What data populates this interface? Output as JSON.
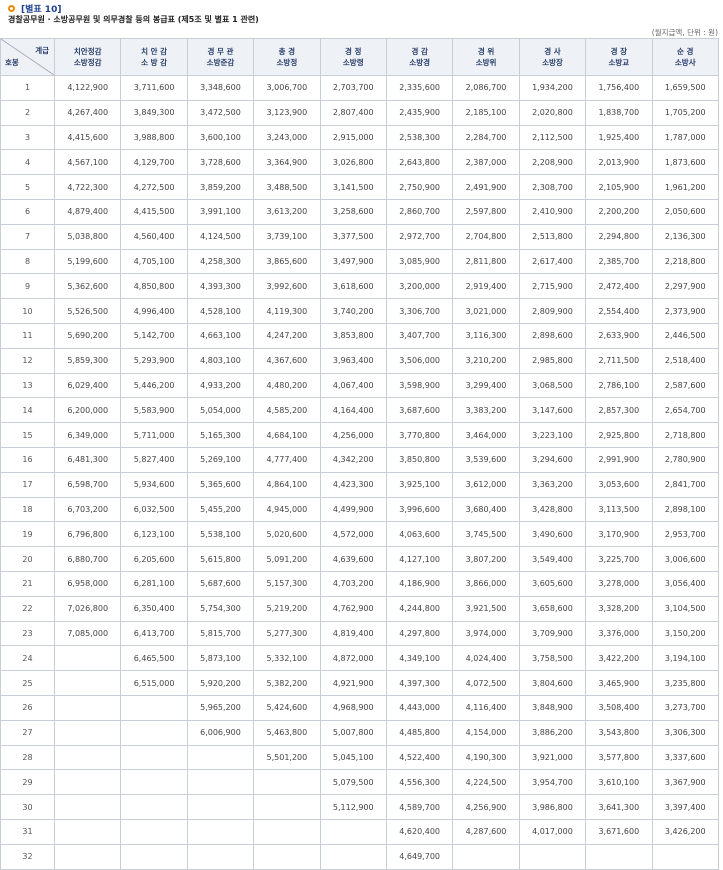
{
  "header": {
    "tag": "[별표 10]",
    "subtitle": "경찰공무원 · 소방공무원 및 의무경찰 등의 봉급표 (제5조 및 별표 1 관련)",
    "unit": "(월지급액, 단위 : 원)"
  },
  "table": {
    "corner_top": "계급",
    "corner_bottom": "호봉",
    "columns": [
      {
        "l1": "치안정감",
        "l2": "소방정감"
      },
      {
        "l1": "치 안 감",
        "l2": "소 방 감"
      },
      {
        "l1": "경 무 관",
        "l2": "소방준감"
      },
      {
        "l1": "총 경",
        "l2": "소방정"
      },
      {
        "l1": "경 정",
        "l2": "소방령"
      },
      {
        "l1": "경 감",
        "l2": "소방경"
      },
      {
        "l1": "경 위",
        "l2": "소방위"
      },
      {
        "l1": "경 사",
        "l2": "소방장"
      },
      {
        "l1": "경 장",
        "l2": "소방교"
      },
      {
        "l1": "순 경",
        "l2": "소방사"
      }
    ],
    "rows": [
      {
        "no": "1",
        "v": [
          "4,122,900",
          "3,711,600",
          "3,348,600",
          "3,006,700",
          "2,703,700",
          "2,335,600",
          "2,086,700",
          "1,934,200",
          "1,756,400",
          "1,659,500"
        ]
      },
      {
        "no": "2",
        "v": [
          "4,267,400",
          "3,849,300",
          "3,472,500",
          "3,123,900",
          "2,807,400",
          "2,435,900",
          "2,185,100",
          "2,020,800",
          "1,838,700",
          "1,705,200"
        ]
      },
      {
        "no": "3",
        "v": [
          "4,415,600",
          "3,988,800",
          "3,600,100",
          "3,243,000",
          "2,915,000",
          "2,538,300",
          "2,284,700",
          "2,112,500",
          "1,925,400",
          "1,787,000"
        ]
      },
      {
        "no": "4",
        "v": [
          "4,567,100",
          "4,129,700",
          "3,728,600",
          "3,364,900",
          "3,026,800",
          "2,643,800",
          "2,387,000",
          "2,208,900",
          "2,013,900",
          "1,873,600"
        ]
      },
      {
        "no": "5",
        "v": [
          "4,722,300",
          "4,272,500",
          "3,859,200",
          "3,488,500",
          "3,141,500",
          "2,750,900",
          "2,491,900",
          "2,308,700",
          "2,105,900",
          "1,961,200"
        ]
      },
      {
        "no": "6",
        "v": [
          "4,879,400",
          "4,415,500",
          "3,991,100",
          "3,613,200",
          "3,258,600",
          "2,860,700",
          "2,597,800",
          "2,410,900",
          "2,200,200",
          "2,050,600"
        ]
      },
      {
        "no": "7",
        "v": [
          "5,038,800",
          "4,560,400",
          "4,124,500",
          "3,739,100",
          "3,377,500",
          "2,972,700",
          "2,704,800",
          "2,513,800",
          "2,294,800",
          "2,136,300"
        ]
      },
      {
        "no": "8",
        "v": [
          "5,199,600",
          "4,705,100",
          "4,258,300",
          "3,865,600",
          "3,497,900",
          "3,085,900",
          "2,811,800",
          "2,617,400",
          "2,385,700",
          "2,218,800"
        ]
      },
      {
        "no": "9",
        "v": [
          "5,362,600",
          "4,850,800",
          "4,393,300",
          "3,992,600",
          "3,618,600",
          "3,200,000",
          "2,919,400",
          "2,715,900",
          "2,472,400",
          "2,297,900"
        ]
      },
      {
        "no": "10",
        "v": [
          "5,526,500",
          "4,996,400",
          "4,528,100",
          "4,119,300",
          "3,740,200",
          "3,306,700",
          "3,021,000",
          "2,809,900",
          "2,554,400",
          "2,373,900"
        ]
      },
      {
        "no": "11",
        "v": [
          "5,690,200",
          "5,142,700",
          "4,663,100",
          "4,247,200",
          "3,853,800",
          "3,407,700",
          "3,116,300",
          "2,898,600",
          "2,633,900",
          "2,446,500"
        ]
      },
      {
        "no": "12",
        "v": [
          "5,859,300",
          "5,293,900",
          "4,803,100",
          "4,367,600",
          "3,963,400",
          "3,506,000",
          "3,210,200",
          "2,985,800",
          "2,711,500",
          "2,518,400"
        ]
      },
      {
        "no": "13",
        "v": [
          "6,029,400",
          "5,446,200",
          "4,933,200",
          "4,480,200",
          "4,067,400",
          "3,598,900",
          "3,299,400",
          "3,068,500",
          "2,786,100",
          "2,587,600"
        ]
      },
      {
        "no": "14",
        "v": [
          "6,200,000",
          "5,583,900",
          "5,054,000",
          "4,585,200",
          "4,164,400",
          "3,687,600",
          "3,383,200",
          "3,147,600",
          "2,857,300",
          "2,654,700"
        ]
      },
      {
        "no": "15",
        "v": [
          "6,349,000",
          "5,711,000",
          "5,165,300",
          "4,684,100",
          "4,256,000",
          "3,770,800",
          "3,464,000",
          "3,223,100",
          "2,925,800",
          "2,718,800"
        ]
      },
      {
        "no": "16",
        "v": [
          "6,481,300",
          "5,827,400",
          "5,269,100",
          "4,777,400",
          "4,342,200",
          "3,850,800",
          "3,539,600",
          "3,294,600",
          "2,991,900",
          "2,780,900"
        ]
      },
      {
        "no": "17",
        "v": [
          "6,598,700",
          "5,934,600",
          "5,365,600",
          "4,864,100",
          "4,423,300",
          "3,925,100",
          "3,612,000",
          "3,363,200",
          "3,053,600",
          "2,841,700"
        ]
      },
      {
        "no": "18",
        "v": [
          "6,703,200",
          "6,032,500",
          "5,455,200",
          "4,945,000",
          "4,499,900",
          "3,996,600",
          "3,680,400",
          "3,428,800",
          "3,113,500",
          "2,898,100"
        ]
      },
      {
        "no": "19",
        "v": [
          "6,796,800",
          "6,123,100",
          "5,538,100",
          "5,020,600",
          "4,572,000",
          "4,063,600",
          "3,745,500",
          "3,490,600",
          "3,170,900",
          "2,953,700"
        ]
      },
      {
        "no": "20",
        "v": [
          "6,880,700",
          "6,205,600",
          "5,615,800",
          "5,091,200",
          "4,639,600",
          "4,127,100",
          "3,807,200",
          "3,549,400",
          "3,225,700",
          "3,006,600"
        ]
      },
      {
        "no": "21",
        "v": [
          "6,958,000",
          "6,281,100",
          "5,687,600",
          "5,157,300",
          "4,703,200",
          "4,186,900",
          "3,866,000",
          "3,605,600",
          "3,278,000",
          "3,056,400"
        ]
      },
      {
        "no": "22",
        "v": [
          "7,026,800",
          "6,350,400",
          "5,754,300",
          "5,219,200",
          "4,762,900",
          "4,244,800",
          "3,921,500",
          "3,658,600",
          "3,328,200",
          "3,104,500"
        ]
      },
      {
        "no": "23",
        "v": [
          "7,085,000",
          "6,413,700",
          "5,815,700",
          "5,277,300",
          "4,819,400",
          "4,297,800",
          "3,974,000",
          "3,709,900",
          "3,376,000",
          "3,150,200"
        ]
      },
      {
        "no": "24",
        "v": [
          "",
          "6,465,500",
          "5,873,100",
          "5,332,100",
          "4,872,000",
          "4,349,100",
          "4,024,400",
          "3,758,500",
          "3,422,200",
          "3,194,100"
        ]
      },
      {
        "no": "25",
        "v": [
          "",
          "6,515,000",
          "5,920,200",
          "5,382,200",
          "4,921,900",
          "4,397,300",
          "4,072,500",
          "3,804,600",
          "3,465,900",
          "3,235,800"
        ]
      },
      {
        "no": "26",
        "v": [
          "",
          "",
          "5,965,200",
          "5,424,600",
          "4,968,900",
          "4,443,000",
          "4,116,400",
          "3,848,900",
          "3,508,400",
          "3,273,700"
        ]
      },
      {
        "no": "27",
        "v": [
          "",
          "",
          "6,006,900",
          "5,463,800",
          "5,007,800",
          "4,485,800",
          "4,154,000",
          "3,886,200",
          "3,543,800",
          "3,306,300"
        ]
      },
      {
        "no": "28",
        "v": [
          "",
          "",
          "",
          "5,501,200",
          "5,045,100",
          "4,522,400",
          "4,190,300",
          "3,921,000",
          "3,577,800",
          "3,337,600"
        ]
      },
      {
        "no": "29",
        "v": [
          "",
          "",
          "",
          "",
          "5,079,500",
          "4,556,300",
          "4,224,500",
          "3,954,700",
          "3,610,100",
          "3,367,900"
        ]
      },
      {
        "no": "30",
        "v": [
          "",
          "",
          "",
          "",
          "5,112,900",
          "4,589,700",
          "4,256,900",
          "3,986,800",
          "3,641,300",
          "3,397,400"
        ]
      },
      {
        "no": "31",
        "v": [
          "",
          "",
          "",
          "",
          "",
          "4,620,400",
          "4,287,600",
          "4,017,000",
          "3,671,600",
          "3,426,200"
        ]
      },
      {
        "no": "32",
        "v": [
          "",
          "",
          "",
          "",
          "",
          "4,649,700",
          "",
          "",
          "",
          ""
        ]
      }
    ]
  }
}
